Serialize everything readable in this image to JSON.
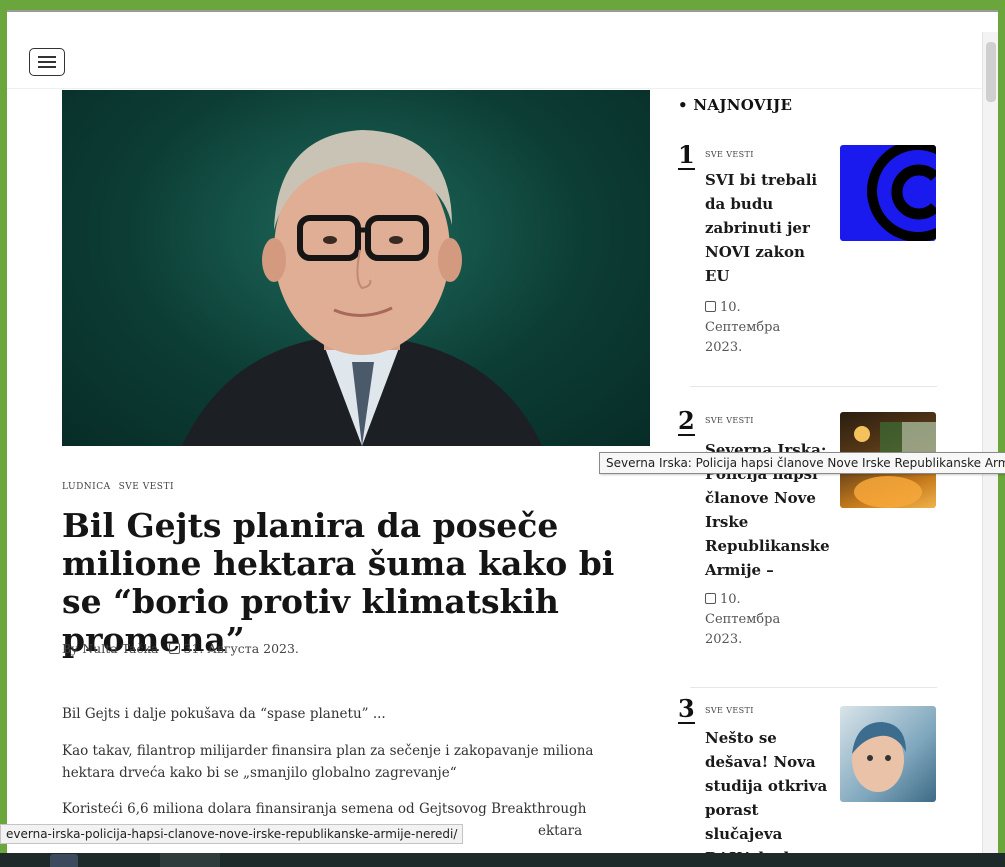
{
  "menu": {
    "label": ""
  },
  "hero": {
    "alt": ""
  },
  "article": {
    "categories": [
      "LUDNICA",
      "SVE VESTI"
    ],
    "title": "Bil Gejts planira da poseče milione hektara šuma kako bi se “borio protiv klimatskih promena”",
    "author": "By Nulta Tačka",
    "date": "31. Августа 2023.",
    "paragraphs": [
      "Bil Gejts i dalje pokušava da “spase planetu” ...",
      "Kao takav, filantrop milijarder finansira plan za sečenje i zakopavanje miliona hektara drveća kako bi se „smanjilo globalno zagrevanje“",
      "Koristeći 6,6 miliona dolara finansiranja semena od Gejtsovog Breakthrough",
      "ektara"
    ]
  },
  "sidebar": {
    "title": "• NAJNOVIJE",
    "items": [
      {
        "num": "1",
        "cat": "SVE VESTI",
        "title": "SVI bi trebali da budu zabrinuti jer NOVI zakon EU",
        "date": "10. Септембра 2023."
      },
      {
        "num": "2",
        "cat": "SVE VESTI",
        "title": "Severna Irska: Policija hapsi članove Nove Irske Republikanske Armije –",
        "date": "10. Септембра 2023."
      },
      {
        "num": "3",
        "cat": "SVE VESTI",
        "title": "Nešto se dešava! Nova studija otkriva porast slučajeva RAKA kod",
        "date": ""
      }
    ]
  },
  "tooltip": "Severna Irska: Policija hapsi članove Nove Irske Republikanske Armije",
  "status_url": "everna-irska-policija-hapsi-clanove-nove-irske-republikanske-armije-neredi/",
  "colors": {
    "frame": "#6aa63c",
    "hero_bg": "#0c3d35",
    "thumb1": "#1a1aee",
    "accent": "#111111"
  }
}
